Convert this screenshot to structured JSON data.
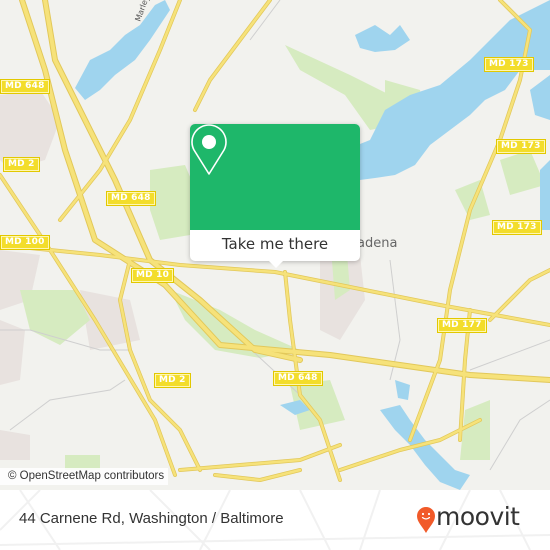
{
  "map": {
    "route_shields": [
      {
        "id": "md648-nw",
        "label": "MD 648"
      },
      {
        "id": "md2-w",
        "label": "MD 2"
      },
      {
        "id": "md648-w",
        "label": "MD 648"
      },
      {
        "id": "md100",
        "label": "MD 100"
      },
      {
        "id": "md10",
        "label": "MD 10"
      },
      {
        "id": "md2-s",
        "label": "MD 2"
      },
      {
        "id": "md648-s",
        "label": "MD 648"
      },
      {
        "id": "md173-top",
        "label": "MD 173"
      },
      {
        "id": "md173-mid",
        "label": "MD 173"
      },
      {
        "id": "md173-low",
        "label": "MD 173"
      },
      {
        "id": "md177",
        "label": "MD 177"
      }
    ],
    "place_labels": {
      "pasadena": "Pasadena",
      "river": "Marley Creek"
    },
    "attribution": "© OpenStreetMap contributors",
    "colors": {
      "land": "#f2f2ee",
      "water": "#9fd4ee",
      "park": "#d6ebc0",
      "urban": "#e8e2df",
      "road": "#f6e27a",
      "road_casing": "#e2c85a",
      "shield": "#f3dd2b"
    }
  },
  "popup": {
    "button_label": "Take me there",
    "icon": "map-pin-icon",
    "color": "#1eb76a"
  },
  "footer": {
    "address": "44 Carnene Rd, Washington / Baltimore",
    "brand": "moovit",
    "brand_icon": "moovit-pin-icon",
    "brand_color": "#f15a29"
  }
}
